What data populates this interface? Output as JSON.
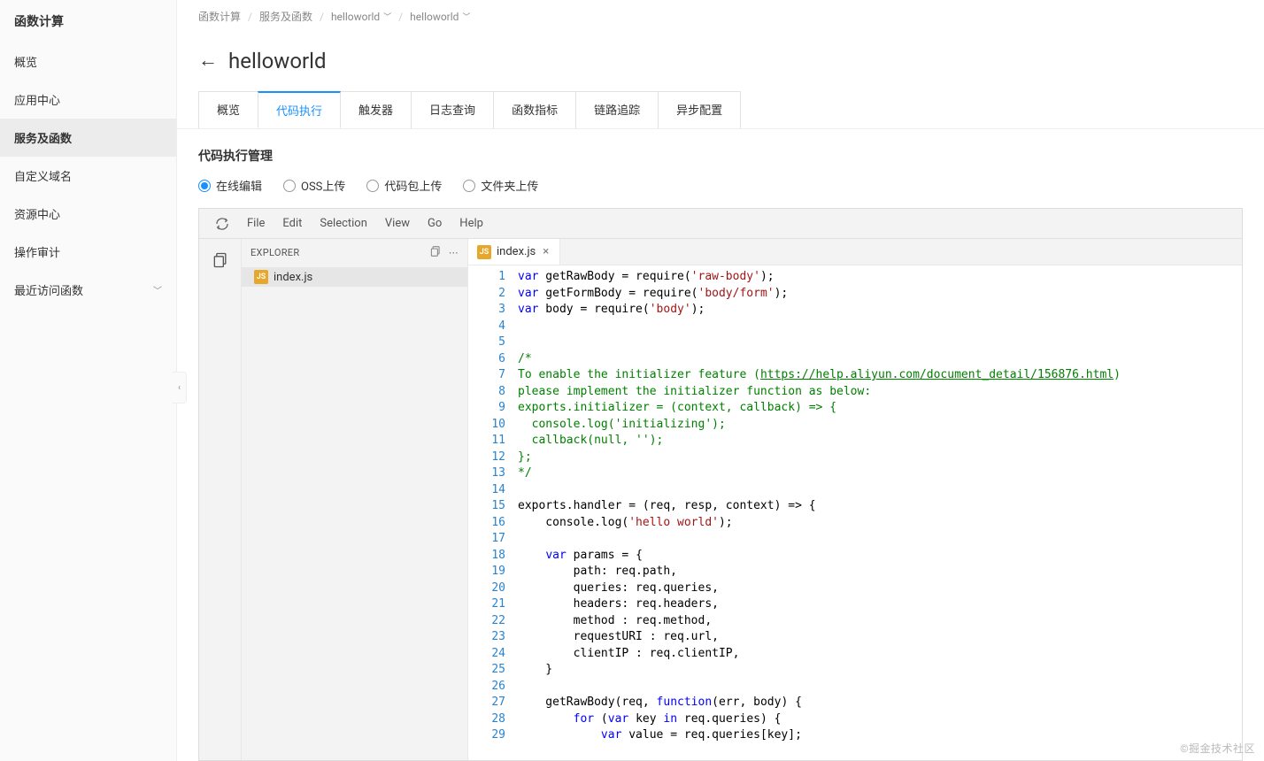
{
  "sidebar": {
    "title": "函数计算",
    "items": [
      {
        "label": "概览"
      },
      {
        "label": "应用中心"
      },
      {
        "label": "服务及函数",
        "active": true
      },
      {
        "label": "自定义域名"
      },
      {
        "label": "资源中心"
      },
      {
        "label": "操作审计"
      },
      {
        "label": "最近访问函数",
        "chevron": true
      }
    ]
  },
  "breadcrumb": {
    "items": [
      "函数计算",
      "服务及函数",
      "helloworld",
      "helloworld"
    ],
    "dropdown_on": [
      2,
      3
    ]
  },
  "page": {
    "title": "helloworld"
  },
  "tabs": {
    "items": [
      "概览",
      "代码执行",
      "触发器",
      "日志查询",
      "函数指标",
      "链路追踪",
      "异步配置"
    ],
    "active_index": 1
  },
  "section": {
    "title": "代码执行管理"
  },
  "radios": {
    "items": [
      "在线编辑",
      "OSS上传",
      "代码包上传",
      "文件夹上传"
    ],
    "selected_index": 0
  },
  "ide": {
    "menu": [
      "File",
      "Edit",
      "Selection",
      "View",
      "Go",
      "Help"
    ],
    "explorer": {
      "title": "EXPLORER",
      "file": {
        "name": "index.js",
        "badge": "JS"
      }
    },
    "open_tab": {
      "name": "index.js",
      "badge": "JS"
    },
    "code": {
      "line_count": 29,
      "lines": [
        [
          [
            "kw",
            "var"
          ],
          [
            "id",
            " getRawBody = require("
          ],
          [
            "str",
            "'raw-body'"
          ],
          [
            "id",
            ");"
          ]
        ],
        [
          [
            "kw",
            "var"
          ],
          [
            "id",
            " getFormBody = require("
          ],
          [
            "str",
            "'body/form'"
          ],
          [
            "id",
            ");"
          ]
        ],
        [
          [
            "kw",
            "var"
          ],
          [
            "id",
            " body = require("
          ],
          [
            "str",
            "'body'"
          ],
          [
            "id",
            ");"
          ]
        ],
        [],
        [],
        [
          [
            "com",
            "/*"
          ]
        ],
        [
          [
            "com",
            "To enable the initializer feature ("
          ],
          [
            "link",
            "https://help.aliyun.com/document_detail/156876.html"
          ],
          [
            "com",
            ")"
          ]
        ],
        [
          [
            "com",
            "please implement the initializer function as below:"
          ]
        ],
        [
          [
            "com",
            "exports.initializer = (context, callback) => {"
          ]
        ],
        [
          [
            "com",
            "  console.log('initializing');"
          ]
        ],
        [
          [
            "com",
            "  callback(null, '');"
          ]
        ],
        [
          [
            "com",
            "};"
          ]
        ],
        [
          [
            "com",
            "*/"
          ]
        ],
        [],
        [
          [
            "id",
            "exports.handler = (req, resp, context) => {"
          ]
        ],
        [
          [
            "id",
            "    console.log("
          ],
          [
            "str",
            "'hello world'"
          ],
          [
            "id",
            ");"
          ]
        ],
        [],
        [
          [
            "id",
            "    "
          ],
          [
            "kw",
            "var"
          ],
          [
            "id",
            " params = {"
          ]
        ],
        [
          [
            "id",
            "        path: req.path,"
          ]
        ],
        [
          [
            "id",
            "        queries: req.queries,"
          ]
        ],
        [
          [
            "id",
            "        headers: req.headers,"
          ]
        ],
        [
          [
            "id",
            "        method : req.method,"
          ]
        ],
        [
          [
            "id",
            "        requestURI : req.url,"
          ]
        ],
        [
          [
            "id",
            "        clientIP : req.clientIP,"
          ]
        ],
        [
          [
            "id",
            "    }"
          ]
        ],
        [],
        [
          [
            "id",
            "    getRawBody(req, "
          ],
          [
            "kw",
            "function"
          ],
          [
            "id",
            "(err, body) {"
          ]
        ],
        [
          [
            "id",
            "        "
          ],
          [
            "kw",
            "for"
          ],
          [
            "id",
            " ("
          ],
          [
            "kw",
            "var"
          ],
          [
            "id",
            " key "
          ],
          [
            "kw",
            "in"
          ],
          [
            "id",
            " req.queries) {"
          ]
        ],
        [
          [
            "id",
            "            "
          ],
          [
            "kw",
            "var"
          ],
          [
            "id",
            " value = req.queries[key];"
          ]
        ]
      ]
    }
  },
  "watermark": "©掘金技术社区"
}
